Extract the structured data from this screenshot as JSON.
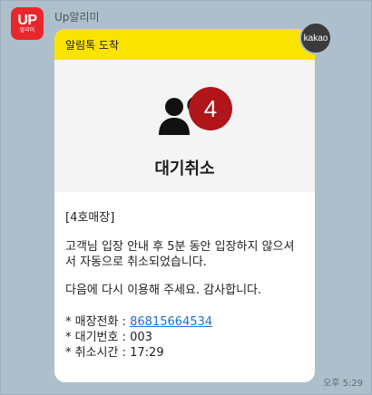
{
  "app_icon": {
    "big": "UP",
    "small": "알리미"
  },
  "sender": "Up알리미",
  "kakao_badge": "kakao",
  "bubble": {
    "header": "알림톡 도착",
    "hero_title": "대기취소",
    "badge_number": "4",
    "store": "[4호매장]",
    "notice": "고객님 입장 안내 후 5분 동안 입장하지 않으셔서 자동으로 취소되었습니다.",
    "thanks": "다음에 다시 이용해 주세요. 감사합니다.",
    "info": {
      "phone_label": "* 매장전화 : ",
      "phone": "86815664534",
      "queue_label": "* 대기번호 : ",
      "queue": "003",
      "cancel_label": "* 취소시간 : ",
      "cancel_time": "17:29"
    }
  },
  "timestamp": "오후 5:29",
  "icons": [
    "person-cancel-icon"
  ],
  "colors": {
    "header": "#fbe300",
    "app_icon": "#e8272c",
    "badge": "#b01519",
    "link": "#1f6fd0"
  }
}
